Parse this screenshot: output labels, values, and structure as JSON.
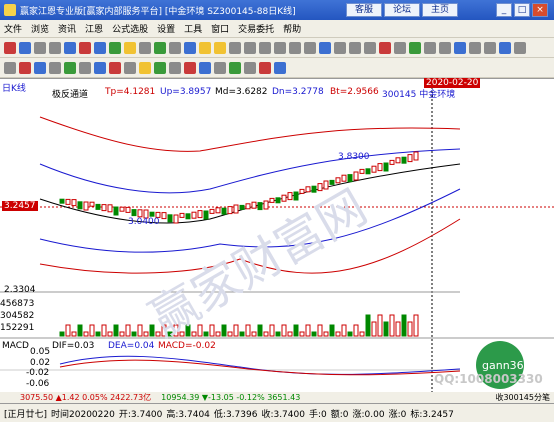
{
  "window": {
    "title": "赢家江恩专业版[赢家内部服务平台]   [中金环境   SZ300145-88日K线]",
    "buttons": [
      "客服",
      "论坛",
      "主页"
    ]
  },
  "menu": [
    "文件",
    "浏览",
    "资讯",
    "江恩",
    "公式选股",
    "设置",
    "工具",
    "窗口",
    "交易委托",
    "帮助"
  ],
  "chart": {
    "period_label": "日K线",
    "indicator_name": "极反通道",
    "tp": "Tp=4.1281",
    "up": "Up=3.8957",
    "md": "Md=3.6282",
    "dn": "Dn=3.2778",
    "bt": "Bt=2.9566",
    "stock": "300145   中金环境",
    "date_tag": "2020-02-20",
    "price_tag": "3.2457",
    "high_label": "3.8300",
    "low_label": "3.0400",
    "axis_low": "2.3304",
    "vol_ticks": [
      "456873",
      "304582",
      "152291"
    ],
    "macd_title": "MACD",
    "dif": "DIF=0.03",
    "dea": "DEA=0.04",
    "macd": "MACD=-0.02",
    "macd_ticks": [
      "0.05",
      "0.02",
      "-0.02",
      "-0.06"
    ],
    "watermark": "赢家财富网",
    "watermark_url": "www.yingjia360.com",
    "logo": "gann360",
    "qq": "QQ:1008003330"
  },
  "status": {
    "period": "[正月廿七]",
    "time": "时间20200220",
    "open": "开:3.7400",
    "high": "高:3.7404",
    "low": "低:3.7396",
    "close": "收:3.7400",
    "hand": "手:0",
    "amount": "额:0",
    "change": "涨:0.00",
    "amp": "涨:0",
    "index1": "3075.50 ▲1.42 0.05% 2422.73亿",
    "index2": "10954.39 ▼-13.05 -0.12% 3651.43",
    "rec": "收300145分笔",
    "price_right": "标:3.2457"
  }
}
